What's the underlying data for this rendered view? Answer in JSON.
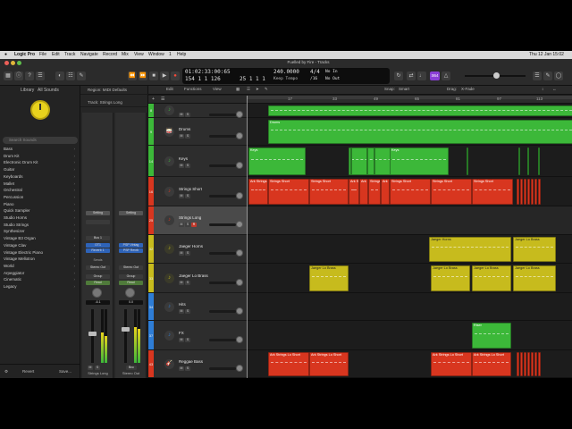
{
  "menubar": {
    "app_name": "Logic Pro",
    "items": [
      "File",
      "Edit",
      "Track",
      "Navigate",
      "Record",
      "Mix",
      "View",
      "Window",
      "1",
      "Help"
    ],
    "clock": "Thu 12 Jan  15:02"
  },
  "window": {
    "title": "Fuelled by Fire - Tracks"
  },
  "lcd": {
    "smpte": "01:02:33:00:65",
    "bars": "154  1  1  126",
    "bars2": "25  1  1  1",
    "tempo": "240.0000",
    "tempo_label": "Keep Tempo",
    "signature": "4/4",
    "division": "/16",
    "in_label": "No In",
    "out_label": "No Out"
  },
  "toolbar_badge": "Ǝ64",
  "library": {
    "title": "Library",
    "filter": "All Sounds",
    "search_placeholder": "Search Sounds",
    "items": [
      "Bass",
      "Drum Kit",
      "Electronic Drum Kit",
      "Guitar",
      "Keyboards",
      "Mallet",
      "Orchestral",
      "Percussion",
      "Piano",
      "Quick Sampler",
      "Studio Horns",
      "Studio Strings",
      "Synthesizer",
      "Vintage B3 Organ",
      "Vintage Clav",
      "Vintage Electric Piano",
      "Vintage Mellotron",
      "World",
      "Arpeggiator",
      "Cinematic",
      "Legacy"
    ],
    "revert": "Revert",
    "save": "Save..."
  },
  "inspector": {
    "region_label": "Region: MIDI Defaults",
    "track_label": "Track: Strings Long",
    "left": {
      "setting": "Setting",
      "eq": "EQ",
      "midi": "Bus 1",
      "slot1": "OT1",
      "slot2": "Reverb 1",
      "sends": "Sends",
      "output": "Stereo Out",
      "group": "Group",
      "automation": "Read",
      "volume": "-6.1",
      "name": "Strings Long"
    },
    "right": {
      "setting": "Setting",
      "slot1": "PSP Vintag",
      "slot2": "PSP Revrb",
      "output": "Stereo Out",
      "group": "Group",
      "automation": "Read",
      "volume": "0.0",
      "bnc": "Bnc",
      "name": "Stereo Out"
    }
  },
  "tracks_header": {
    "edit": "Edit",
    "functions": "Functions",
    "view": "View",
    "snap_label": "Snap:",
    "snap": "Smart",
    "drag_label": "Drag:",
    "drag": "X-Fade"
  },
  "ruler": [
    "17",
    "33",
    "49",
    "65",
    "81",
    "97",
    "113"
  ],
  "tracks": [
    {
      "num": "8",
      "name": "",
      "color": "#3cb839",
      "selected": false
    },
    {
      "num": "9",
      "name": "Drums",
      "color": "#3cb839",
      "selected": false
    },
    {
      "num": "14",
      "name": "Keys",
      "color": "#3cb839",
      "selected": false
    },
    {
      "num": "16",
      "name": "Strings Short",
      "color": "#d8361f",
      "selected": false
    },
    {
      "num": "25",
      "name": "Strings Long",
      "color": "#d8361f",
      "selected": true
    },
    {
      "num": "32",
      "name": "Jaeger Horns",
      "color": "#c7bb1d",
      "selected": false
    },
    {
      "num": "33",
      "name": "Jaeger Lo Brass",
      "color": "#c7bb1d",
      "selected": false
    },
    {
      "num": "34",
      "name": "Hits",
      "color": "#2e7dd6",
      "selected": false
    },
    {
      "num": "37",
      "name": "FX",
      "color": "#2e7dd6",
      "selected": false
    },
    {
      "num": "43",
      "name": "Reggae Bass",
      "color": "#d8361f",
      "selected": false
    }
  ],
  "region_labels": {
    "drums": "Drums",
    "keys": "Keys",
    "ark_strings": "Ark Strings",
    "strings_short": "Strings Short",
    "ark_strings_lo_short": "Ark Strings Lo Short",
    "jaeger_horns": "Jaeger Horns",
    "jaeger_lo_brass": "Jaeger Lo Brass",
    "riser": "Riser"
  },
  "colors": {
    "green": "#3cb839",
    "red": "#d8361f",
    "yellow": "#c7bb1d",
    "blue": "#2e7dd6",
    "purple": "#8a3fd6"
  }
}
